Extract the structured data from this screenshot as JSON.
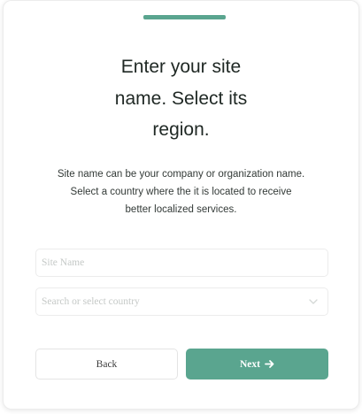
{
  "header": {
    "title_lines": [
      "Enter your site",
      "name. Select its",
      "region."
    ],
    "description_lines": [
      "Site name can be your company or organization name.",
      "Select a country where the it is located to receive",
      "better localized services."
    ]
  },
  "form": {
    "site_name": {
      "placeholder": "Site Name",
      "value": ""
    },
    "country": {
      "placeholder": "Search or select country",
      "value": ""
    }
  },
  "actions": {
    "back_label": "Back",
    "next_label": "Next"
  },
  "icons": {
    "country_dropdown": "chevron-down-icon",
    "next_arrow": "arrow-right-icon"
  },
  "colors": {
    "accent": "#5aa58f",
    "primary_button": "#5aa58f"
  }
}
